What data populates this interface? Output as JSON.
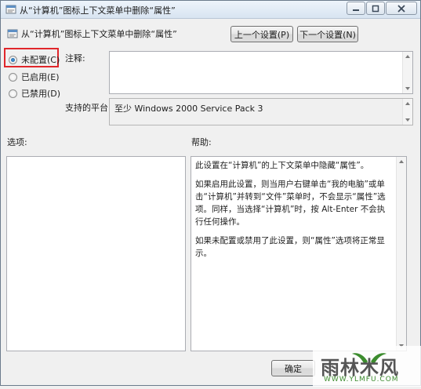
{
  "window": {
    "title": "从“计算机”图标上下文菜单中删除“属性”"
  },
  "header": {
    "title": "从“计算机”图标上下文菜单中删除“属性”",
    "prev_button": "上一个设置(P)",
    "next_button": "下一个设置(N)"
  },
  "state": {
    "options": [
      {
        "label": "未配置(C)",
        "selected": true
      },
      {
        "label": "已启用(E)",
        "selected": false
      },
      {
        "label": "已禁用(D)",
        "selected": false
      }
    ]
  },
  "comment": {
    "label": "注释:",
    "value": ""
  },
  "platform": {
    "label": "支持的平台:",
    "value": "至少 Windows 2000 Service Pack 3"
  },
  "options_section": {
    "label": "选项:"
  },
  "help_section": {
    "label": "帮助:",
    "paragraphs": [
      "此设置在“计算机”的上下文菜单中隐藏“属性”。",
      "如果启用此设置，则当用户右键单击“我的电脑”或单击“计算机”并转到“文件”菜单时，不会显示“属性”选项。同样，当选择“计算机”时，按 Alt-Enter 不会执行任何操作。",
      "如果未配置或禁用了此设置，则“属性”选项将正常显示。"
    ]
  },
  "footer": {
    "ok_button": "确定"
  },
  "watermark": {
    "text": "雨林木风",
    "url": "WWW.YLMFU.COM"
  },
  "colors": {
    "highlight_border": "#e0262b",
    "watermark_green": "#3c8c2e"
  }
}
